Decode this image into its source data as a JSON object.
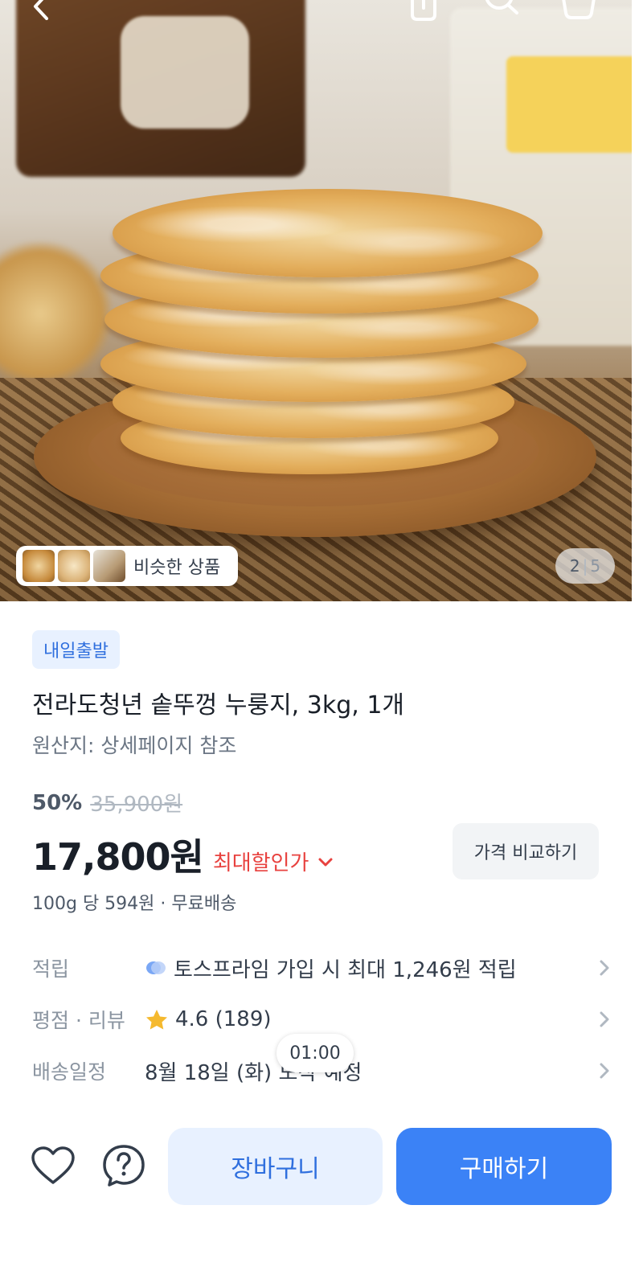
{
  "hero": {
    "similar_products_label": "비슷한 상품",
    "page_current": "2",
    "page_total": "5"
  },
  "product": {
    "badge": "내일출발",
    "title": "전라도청년 솥뚜껑 누룽지, 3kg, 1개",
    "origin": "원산지: 상세페이지 참조",
    "discount_rate": "50%",
    "original_price": "35,900원",
    "sale_price": "17,800원",
    "max_discount_label": "최대할인가",
    "compare_button_label": "가격 비교하기",
    "unit_price": "100g 당 594원 · 무료배송"
  },
  "info_rows": {
    "points": {
      "label": "적립",
      "value": "토스프라임 가입 시 최대 1,246원 적립",
      "icon": "toss-prime-icon"
    },
    "rating": {
      "label": "평점 · 리뷰",
      "value": "4.6 (189)",
      "icon": "star-icon",
      "star_color": "#f5b92e"
    },
    "delivery": {
      "label": "배송일정",
      "value": "8월 18일 (화) 도착 예정"
    }
  },
  "timer": "01:00",
  "bottom_bar": {
    "cart_label": "장바구니",
    "buy_label": "구매하기"
  },
  "colors": {
    "accent": "#3b82f6",
    "accent_light": "#e8f1ff",
    "discount_red": "#e8423f"
  }
}
